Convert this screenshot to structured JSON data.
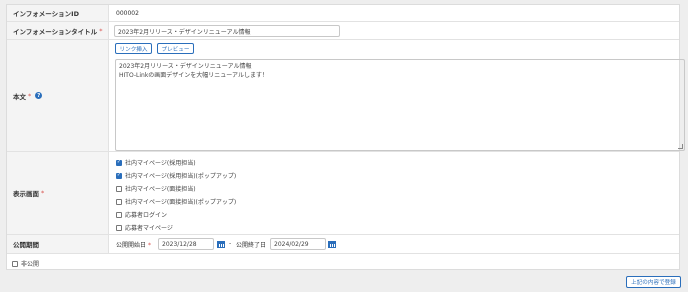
{
  "form": {
    "info_id": {
      "label": "インフォメーションID",
      "value": "000002"
    },
    "title": {
      "label": "インフォメーションタイトル",
      "required_mark": "*",
      "value": "2023年2月リリース・デザインリニューアル情報"
    },
    "body": {
      "label": "本文",
      "required_mark": "*",
      "help_icon": "?",
      "link_button": "リンク挿入",
      "preview_button": "プレビュー",
      "lines": [
        "2023年2月リリース・デザインリニューアル情報",
        "HITO-Linkの画面デザインを大幅リニューアルします！"
      ]
    },
    "display_screens": {
      "label": "表示画面",
      "required_mark": "*",
      "options": [
        {
          "label": "社内マイページ(採用担当)",
          "checked": true
        },
        {
          "label": "社内マイページ(採用担当)(ポップアップ)",
          "checked": true
        },
        {
          "label": "社内マイページ(面接担当)",
          "checked": false
        },
        {
          "label": "社内マイページ(面接担当)(ポップアップ)",
          "checked": false
        },
        {
          "label": "応募者ログイン",
          "checked": false
        },
        {
          "label": "応募者マイページ",
          "checked": false
        }
      ]
    },
    "period": {
      "label": "公開期間",
      "start_label": "公開開始日",
      "required_mark": "*",
      "start_value": "2023/12/28",
      "separator": "-",
      "end_label": "公開終了日",
      "end_value": "2024/02/29"
    },
    "private": {
      "label": "非公開",
      "checked": false
    }
  },
  "submit_label": "上記の内容で登録",
  "colors": {
    "accent": "#2a6ebb",
    "required": "#d9534f"
  }
}
